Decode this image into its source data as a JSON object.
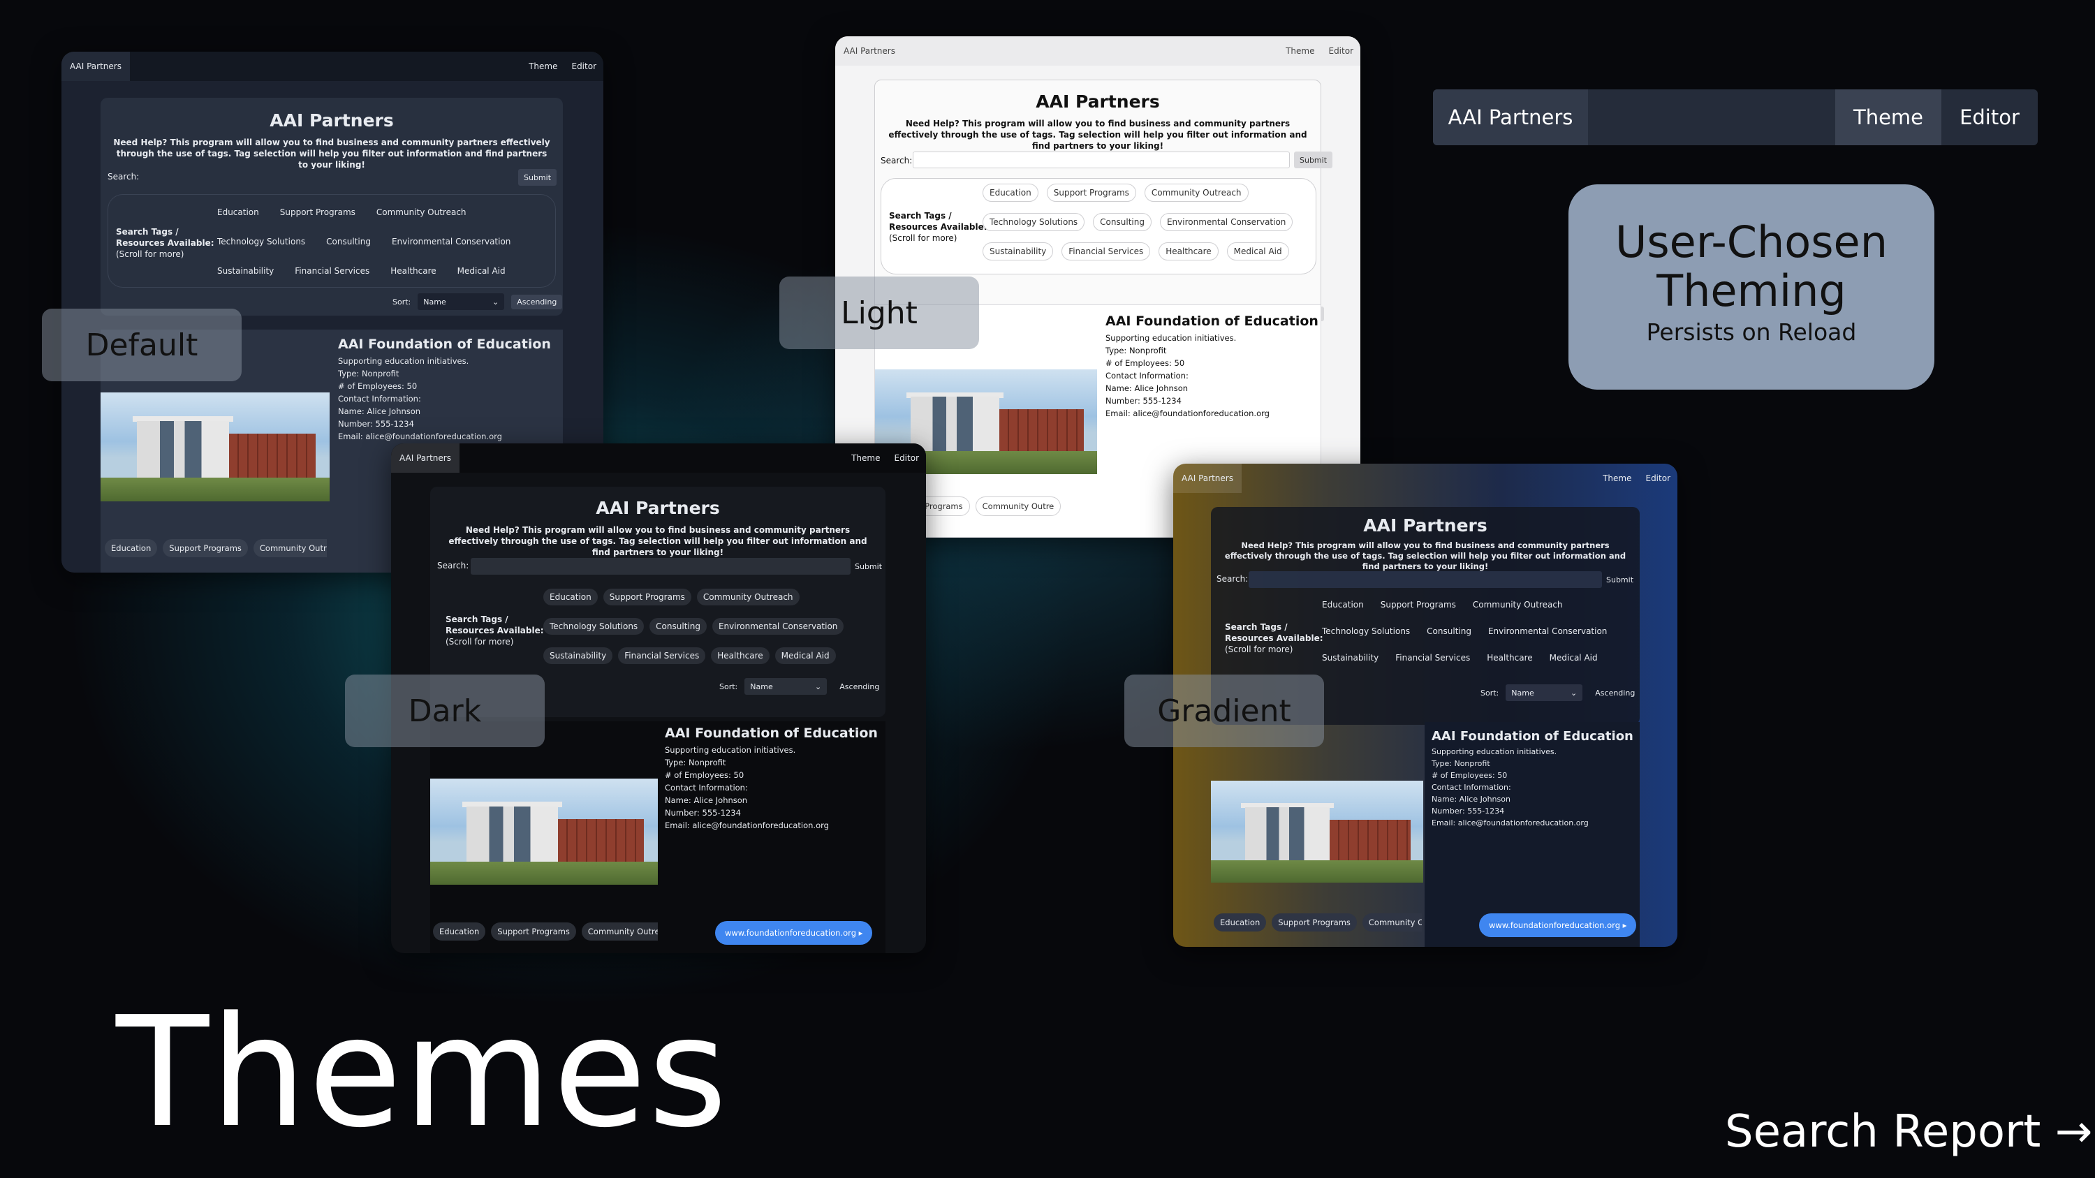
{
  "app": {
    "brand": "AAI Partners",
    "nav_theme": "Theme",
    "nav_editor": "Editor",
    "title": "AAI Partners",
    "help_text": "Need Help? This program will allow you to find business and community partners effectively through the use of tags. Tag selection will help you filter out information and find partners to your liking!",
    "search_label": "Search:",
    "submit_label": "Submit",
    "tags_label_line1": "Search Tags /",
    "tags_label_line2": "Resources Available:",
    "tags_label_hint": "(Scroll for more)",
    "tags": [
      "Education",
      "Support Programs",
      "Community Outreach",
      "Technology Solutions",
      "Consulting",
      "Environmental Conservation",
      "Sustainability",
      "Financial Services",
      "Healthcare",
      "Medical Aid"
    ],
    "sort_label": "Sort:",
    "sort_value": "Name",
    "order_label": "Ascending",
    "card": {
      "name": "AAI Foundation of Education",
      "desc": "Supporting education initiatives.",
      "type": "Type: Nonprofit",
      "employees": "# of Employees: 50",
      "contact": "Contact Information:",
      "contact_name": "Name: Alice Johnson",
      "number": "Number: 555-1234",
      "email": "Email: alice@foundationforeducation.org",
      "tags": [
        "Education",
        "Support Programs",
        "Community Outre"
      ],
      "url": "www.foundationforeducation.org"
    }
  },
  "themes": [
    "Default",
    "Light",
    "Dark",
    "Gradient"
  ],
  "nav": {
    "brand": "AAI Partners",
    "theme": "Theme",
    "editor": "Editor"
  },
  "callout": {
    "title": "User-Chosen Theming",
    "subtitle": "Persists on Reload"
  },
  "page_title": "Themes",
  "next_link": "Search Report →"
}
